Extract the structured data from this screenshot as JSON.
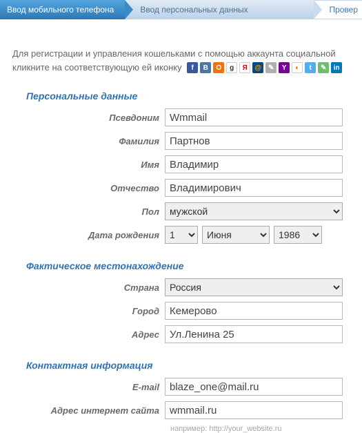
{
  "steps": {
    "s1": "Ввод мобильного телефона",
    "s2": "Ввод персональных данных",
    "s3": "Провер"
  },
  "intro": {
    "line1": "Для регистрации и управления кошельками с помощью аккаунта социальной",
    "line2": "кликните на соответствующую ей иконку"
  },
  "social": [
    {
      "name": "facebook-icon",
      "bg": "#3b5998",
      "txt": "f"
    },
    {
      "name": "vkontakte-icon",
      "bg": "#4c75a3",
      "txt": "B"
    },
    {
      "name": "odnoklassniki-icon",
      "bg": "#f2720c",
      "txt": "O"
    },
    {
      "name": "google-icon",
      "bg": "#ffffff",
      "txt": "g",
      "fg": "#333"
    },
    {
      "name": "yandex-icon",
      "bg": "#ffffff",
      "txt": "Я",
      "fg": "#d00"
    },
    {
      "name": "mailru-icon",
      "bg": "#004b85",
      "txt": "@",
      "fg": "#f90"
    },
    {
      "name": "livejournal-icon",
      "bg": "#b0b0b0",
      "txt": "✎"
    },
    {
      "name": "yahoo-icon",
      "bg": "#7b0099",
      "txt": "Y"
    },
    {
      "name": "openid-icon",
      "bg": "#ffffff",
      "txt": "◐",
      "fg": "#f60"
    },
    {
      "name": "twitter-icon",
      "bg": "#55acee",
      "txt": "t"
    },
    {
      "name": "livejournal2-icon",
      "bg": "#6bc069",
      "txt": "✎"
    },
    {
      "name": "linkedin-icon",
      "bg": "#0077b5",
      "txt": "in"
    }
  ],
  "sections": {
    "personal": "Персональные данные",
    "location": "Фактическое местонахождение",
    "contact": "Контактная информация"
  },
  "labels": {
    "nickname": "Псевдоним",
    "lastname": "Фамилия",
    "firstname": "Имя",
    "patronymic": "Отчество",
    "gender": "Пол",
    "birthdate": "Дата рождения",
    "country": "Страна",
    "city": "Город",
    "address": "Адрес",
    "email": "E-mail",
    "website": "Адрес интернет сайта"
  },
  "values": {
    "nickname": "Wmmail",
    "lastname": "Партнов",
    "firstname": "Владимир",
    "patronymic": "Владимирович",
    "gender": "мужской",
    "birth_day": "1",
    "birth_month": "Июня",
    "birth_year": "1986",
    "country": "Россия",
    "city": "Кемерово",
    "address": "Ул.Ленина 25",
    "email": "blaze_one@mail.ru",
    "website": "wmmail.ru"
  },
  "hints": {
    "website": "например: http://your_website.ru"
  }
}
